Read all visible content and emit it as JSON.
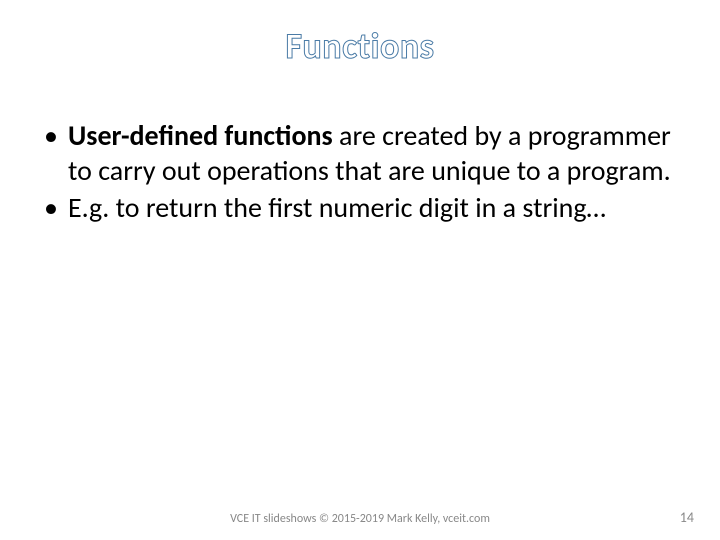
{
  "title": "Functions",
  "bullets": [
    {
      "bold": "User-defined functions",
      "rest": " are created by a programmer to carry out operations that are unique to a program."
    },
    {
      "bold": "",
      "rest": "E.g. to return the first numeric digit in a string…"
    }
  ],
  "footer": {
    "copyright": "VCE IT slideshows © 2015-2019 Mark Kelly, vceit.com",
    "page_number": "14"
  }
}
